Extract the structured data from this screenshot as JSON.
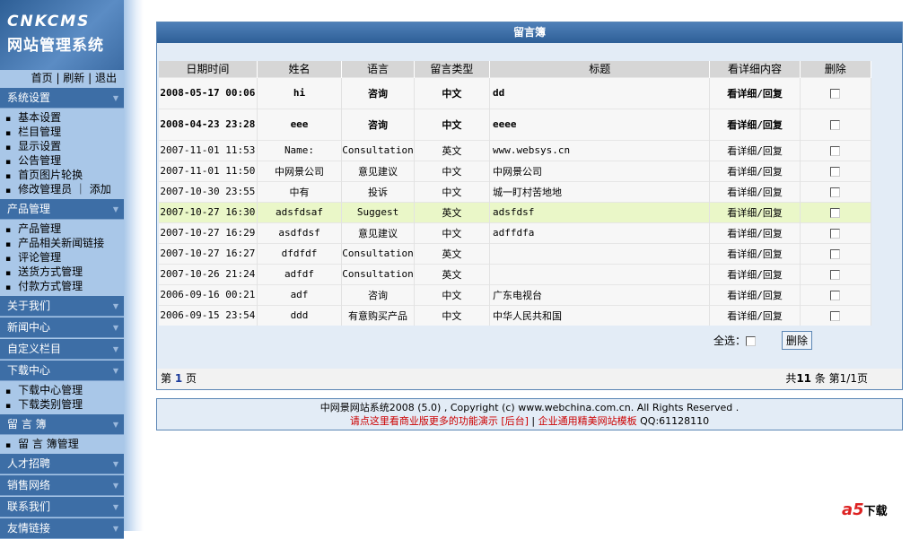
{
  "logo": {
    "line1": "CNKCMS",
    "line2": "网站管理系统"
  },
  "toplinks": [
    "首页",
    "刷新",
    "退出"
  ],
  "sidebar": [
    {
      "title": "系统设置",
      "items": [
        "基本设置",
        "栏目管理",
        "显示设置",
        "公告管理",
        "首页图片轮换",
        "修改管理员 ｜ 添加"
      ]
    },
    {
      "title": "产品管理",
      "items": [
        "产品管理",
        "产品相关新闻链接",
        "评论管理",
        "送货方式管理",
        "付款方式管理"
      ]
    },
    {
      "title": "关于我们",
      "items": []
    },
    {
      "title": "新闻中心",
      "items": []
    },
    {
      "title": "自定义栏目",
      "items": []
    },
    {
      "title": "下载中心",
      "items": [
        "下载中心管理",
        "下载类别管理"
      ]
    },
    {
      "title": "留 言 簿",
      "items": [
        "留 言 簿管理"
      ]
    },
    {
      "title": "人才招聘",
      "items": []
    },
    {
      "title": "销售网络",
      "items": []
    },
    {
      "title": "联系我们",
      "items": []
    },
    {
      "title": "友情链接",
      "items": []
    }
  ],
  "panel": {
    "title": "留言簿",
    "headers": [
      "日期时间",
      "姓名",
      "语言",
      "留言类型",
      "标题",
      "看详细内容",
      "删除"
    ],
    "rows": [
      {
        "date": "2008-05-17 00:06",
        "name": "hi",
        "lang": "咨询",
        "type": "中文",
        "title": "dd",
        "detail": "看详细/回复",
        "bold": true
      },
      {
        "date": "2008-04-23 23:28",
        "name": "eee",
        "lang": "咨询",
        "type": "中文",
        "title": "eeee",
        "detail": "看详细/回复",
        "bold": true
      },
      {
        "date": "2007-11-01 11:53",
        "name": "Name:",
        "lang": "Consultation",
        "type": "英文",
        "title": "www.websys.cn",
        "detail": "看详细/回复"
      },
      {
        "date": "2007-11-01 11:50",
        "name": "中网景公司",
        "lang": "意见建议",
        "type": "中文",
        "title": "中网景公司",
        "detail": "看详细/回复"
      },
      {
        "date": "2007-10-30 23:55",
        "name": "中有",
        "lang": "投诉",
        "type": "中文",
        "title": "城一盯村苦地地",
        "detail": "看详细/回复"
      },
      {
        "date": "2007-10-27 16:30",
        "name": "adsfdsaf",
        "lang": "Suggest",
        "type": "英文",
        "title": "adsfdsf",
        "detail": "看详细/回复",
        "highlight": true
      },
      {
        "date": "2007-10-27 16:29",
        "name": "asdfdsf",
        "lang": "意见建议",
        "type": "中文",
        "title": "adffdfa",
        "detail": "看详细/回复"
      },
      {
        "date": "2007-10-27 16:27",
        "name": "dfdfdf",
        "lang": "Consultation",
        "type": "英文",
        "title": "",
        "detail": "看详细/回复"
      },
      {
        "date": "2007-10-26 21:24",
        "name": "adfdf",
        "lang": "Consultation",
        "type": "英文",
        "title": "",
        "detail": "看详细/回复"
      },
      {
        "date": "2006-09-16 00:21",
        "name": "adf",
        "lang": "咨询",
        "type": "中文",
        "title": "广东电视台",
        "detail": "看详细/回复"
      },
      {
        "date": "2006-09-15 23:54",
        "name": "ddd",
        "lang": "有意购买产品",
        "type": "中文",
        "title": "中华人民共和国",
        "detail": "看详细/回复"
      }
    ],
    "select_all": "全选：",
    "delete_button": "删除",
    "pager": {
      "prefix": "第",
      "page": "1",
      "suffix": "页",
      "total_prefix": "共",
      "total": "11",
      "total_suffix": "条 第1/1页"
    }
  },
  "footer": {
    "line1": "中网景网站系统2008 (5.0) , Copyright (c) www.webchina.com.cn. All Rights Reserved .",
    "demo_link": "请点这里看商业版更多的功能演示",
    "admin_link": "[后台]",
    "sep": " | ",
    "template_link": "企业通用精美网站模板",
    "qq": "QQ:61128110"
  },
  "watermark": {
    "text": "a5",
    "sub": "下载"
  }
}
